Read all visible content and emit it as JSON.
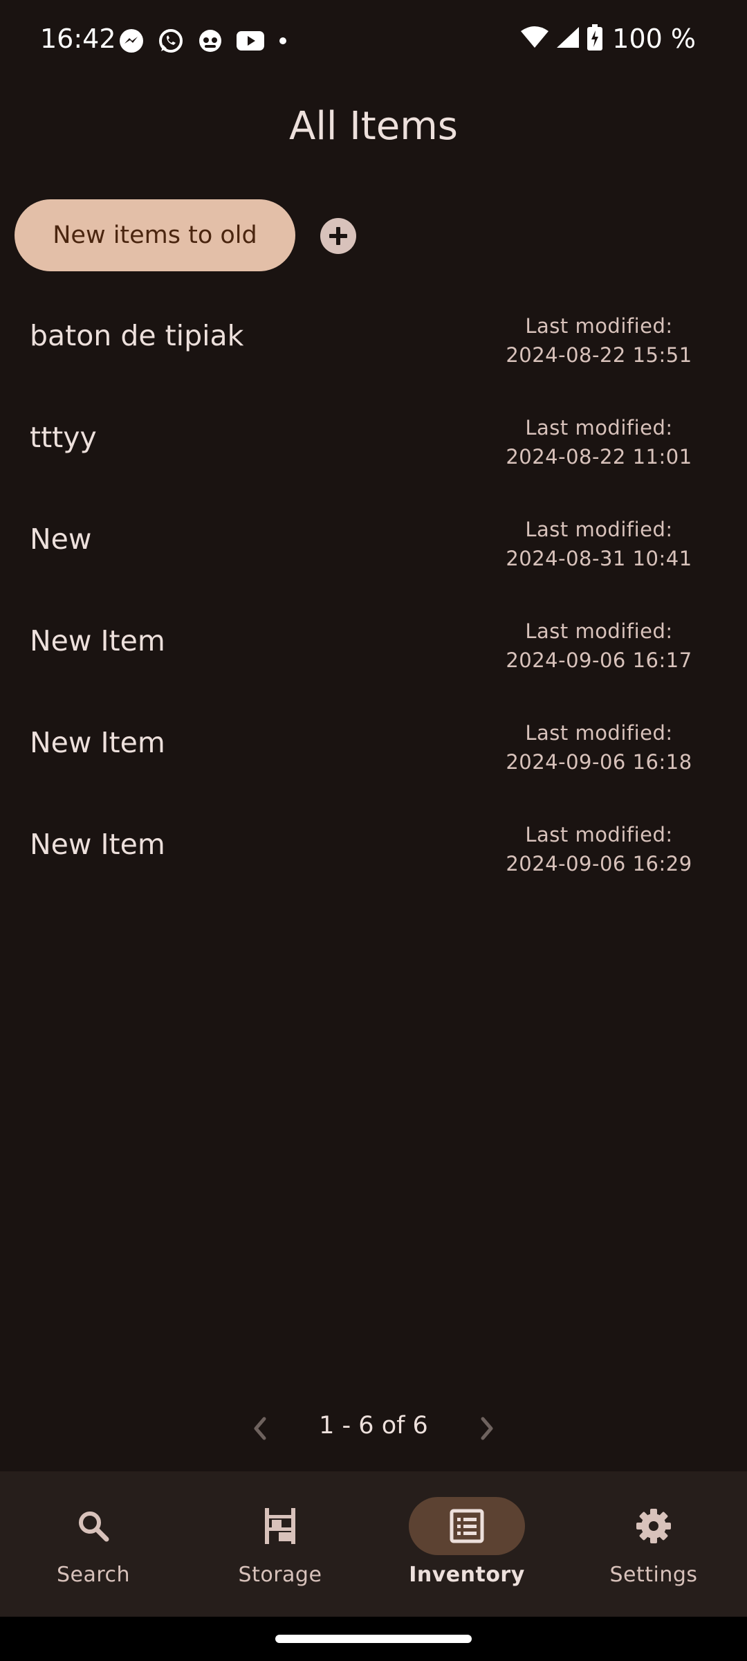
{
  "status_bar": {
    "time": "16:42",
    "notification_icons": [
      "messenger-icon",
      "whatsapp-icon",
      "app-icon",
      "youtube-icon",
      "dot-icon"
    ],
    "battery_text": "100 %"
  },
  "page": {
    "title": "All Items"
  },
  "sort": {
    "label": "New items to old"
  },
  "items": [
    {
      "name": "baton de tipiak",
      "modified_label": "Last modified:",
      "modified_value": "2024-08-22 15:51"
    },
    {
      "name": "tttyy",
      "modified_label": "Last modified:",
      "modified_value": "2024-08-22 11:01"
    },
    {
      "name": "New",
      "modified_label": "Last modified:",
      "modified_value": "2024-08-31 10:41"
    },
    {
      "name": "New Item",
      "modified_label": "Last modified:",
      "modified_value": "2024-09-06 16:17"
    },
    {
      "name": "New Item",
      "modified_label": "Last modified:",
      "modified_value": "2024-09-06 16:18"
    },
    {
      "name": "New Item",
      "modified_label": "Last modified:",
      "modified_value": "2024-09-06 16:29"
    }
  ],
  "pagination": {
    "label": "1 - 6 of 6"
  },
  "bottom_nav": {
    "items": [
      {
        "label": "Search",
        "icon": "search-icon"
      },
      {
        "label": "Storage",
        "icon": "storage-icon"
      },
      {
        "label": "Inventory",
        "icon": "inventory-icon",
        "active": true
      },
      {
        "label": "Settings",
        "icon": "settings-icon"
      }
    ]
  },
  "colors": {
    "background": "#1a1311",
    "chip": "#e3bfa8",
    "chip_text": "#4a250f",
    "nav_background": "#261e1b",
    "nav_active_pill": "#5c4232"
  }
}
